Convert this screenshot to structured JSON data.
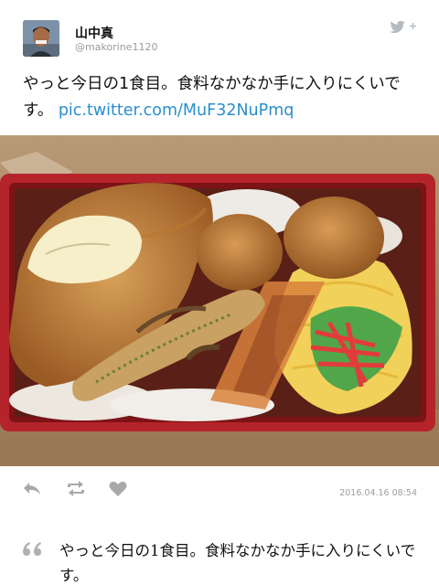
{
  "author": {
    "display_name": "山中真",
    "handle": "@makorine1120"
  },
  "tweet": {
    "text": "やっと今日の1食目。食料なかなか手に入りにくいです。",
    "link": "pic.twitter.com/MuF32NuPmq"
  },
  "meta": {
    "timestamp": "2016.04.16 08:54"
  },
  "actions": {
    "reply_icon": "reply-icon",
    "retweet_icon": "retweet-icon",
    "like_icon": "heart-icon"
  },
  "quote": {
    "text": "やっと今日の1食目。食料なかなか手に入りにくいです。"
  },
  "colors": {
    "link": "#2a8ecc",
    "icon_gray": "#a9a9a9",
    "tray_red": "#b5242a"
  }
}
